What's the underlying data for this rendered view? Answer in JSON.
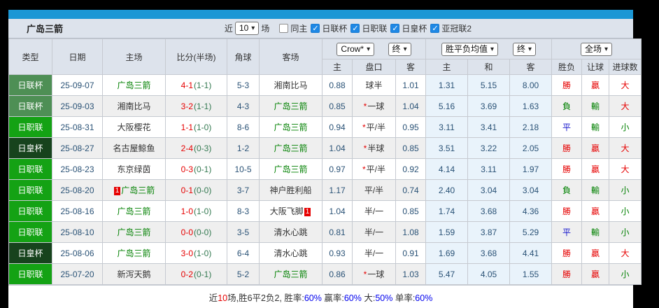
{
  "colors": {
    "accent_blue": "#1b97d5",
    "league_cup_green": "#4e8f55",
    "j_league_green": "#14a214",
    "emperor_cup_green": "#17431d",
    "win_red": "#e60000",
    "lose_green": "#008000",
    "draw_blue": "#1414cc",
    "percent_blue": "#0000ee",
    "avg_column_bg": "#e9f3fb"
  },
  "header": {
    "team": "广岛三箭",
    "recent_label": "近",
    "recent_count": "10",
    "matches_label": "场",
    "filters": [
      {
        "label": "同主",
        "checked": false
      },
      {
        "label": "日联杯",
        "checked": true
      },
      {
        "label": "日职联",
        "checked": true
      },
      {
        "label": "日皇杯",
        "checked": true
      },
      {
        "label": "亚冠联2",
        "checked": true
      }
    ]
  },
  "table": {
    "columns": [
      "类型",
      "日期",
      "主场",
      "比分(半场)",
      "角球",
      "客场"
    ],
    "selects": {
      "bookmaker": "Crow*",
      "asia_time": "终",
      "europe_avg": "胜平负均值",
      "europe_time": "终",
      "scope": "全场"
    },
    "sub_columns": [
      "主",
      "盘口",
      "客",
      "主",
      "和",
      "客",
      "胜负",
      "让球",
      "进球数"
    ],
    "rows": [
      {
        "league": {
          "label": "日联杯",
          "key": "lc"
        },
        "date": "25-09-07",
        "home": {
          "name": "广岛三箭",
          "green": true,
          "rank": ""
        },
        "score": {
          "ft": "4-1",
          "ht": "(1-1)"
        },
        "corners": "5-3",
        "away": {
          "name": "湘南比马",
          "green": false,
          "rank": ""
        },
        "asia": {
          "home": "0.88",
          "star": false,
          "line": "球半",
          "away": "1.01"
        },
        "europe": {
          "home": "1.31",
          "draw": "5.15",
          "away": "8.00"
        },
        "results": [
          {
            "t": "勝",
            "c": "r"
          },
          {
            "t": "贏",
            "c": "r"
          },
          {
            "t": "大",
            "c": "r"
          }
        ]
      },
      {
        "league": {
          "label": "日联杯",
          "key": "lc"
        },
        "date": "25-09-03",
        "home": {
          "name": "湘南比马",
          "green": false,
          "rank": ""
        },
        "score": {
          "ft": "3-2",
          "ht": "(1-1)"
        },
        "corners": "4-3",
        "away": {
          "name": "广岛三箭",
          "green": true,
          "rank": ""
        },
        "asia": {
          "home": "0.85",
          "star": true,
          "line": "一球",
          "away": "1.04"
        },
        "europe": {
          "home": "5.16",
          "draw": "3.69",
          "away": "1.63"
        },
        "results": [
          {
            "t": "負",
            "c": "g"
          },
          {
            "t": "輸",
            "c": "g"
          },
          {
            "t": "大",
            "c": "r"
          }
        ]
      },
      {
        "league": {
          "label": "日职联",
          "key": "jl"
        },
        "date": "25-08-31",
        "home": {
          "name": "大阪樱花",
          "green": false,
          "rank": ""
        },
        "score": {
          "ft": "1-1",
          "ht": "(1-0)"
        },
        "corners": "8-6",
        "away": {
          "name": "广岛三箭",
          "green": true,
          "rank": ""
        },
        "asia": {
          "home": "0.94",
          "star": true,
          "line": "平/半",
          "away": "0.95"
        },
        "europe": {
          "home": "3.11",
          "draw": "3.41",
          "away": "2.18"
        },
        "results": [
          {
            "t": "平",
            "c": "b"
          },
          {
            "t": "輸",
            "c": "g"
          },
          {
            "t": "小",
            "c": "g"
          }
        ]
      },
      {
        "league": {
          "label": "日皇杯",
          "key": "ec"
        },
        "date": "25-08-27",
        "home": {
          "name": "名古屋鲸鱼",
          "green": false,
          "rank": ""
        },
        "score": {
          "ft": "2-4",
          "ht": "(0-3)"
        },
        "corners": "1-2",
        "away": {
          "name": "广岛三箭",
          "green": true,
          "rank": ""
        },
        "asia": {
          "home": "1.04",
          "star": true,
          "line": "半球",
          "away": "0.85"
        },
        "europe": {
          "home": "3.51",
          "draw": "3.22",
          "away": "2.05"
        },
        "results": [
          {
            "t": "勝",
            "c": "r"
          },
          {
            "t": "贏",
            "c": "r"
          },
          {
            "t": "大",
            "c": "r"
          }
        ]
      },
      {
        "league": {
          "label": "日职联",
          "key": "jl"
        },
        "date": "25-08-23",
        "home": {
          "name": "东京绿茵",
          "green": false,
          "rank": ""
        },
        "score": {
          "ft": "0-3",
          "ht": "(0-1)"
        },
        "corners": "10-5",
        "away": {
          "name": "广岛三箭",
          "green": true,
          "rank": ""
        },
        "asia": {
          "home": "0.97",
          "star": true,
          "line": "平/半",
          "away": "0.92"
        },
        "europe": {
          "home": "4.14",
          "draw": "3.11",
          "away": "1.97"
        },
        "results": [
          {
            "t": "勝",
            "c": "r"
          },
          {
            "t": "贏",
            "c": "r"
          },
          {
            "t": "大",
            "c": "r"
          }
        ]
      },
      {
        "league": {
          "label": "日职联",
          "key": "jl"
        },
        "date": "25-08-20",
        "home": {
          "name": "广岛三箭",
          "green": true,
          "rank": "1"
        },
        "score": {
          "ft": "0-1",
          "ht": "(0-0)"
        },
        "corners": "3-7",
        "away": {
          "name": "神户胜利船",
          "green": false,
          "rank": ""
        },
        "asia": {
          "home": "1.17",
          "star": false,
          "line": "平/半",
          "away": "0.74"
        },
        "europe": {
          "home": "2.40",
          "draw": "3.04",
          "away": "3.04"
        },
        "results": [
          {
            "t": "負",
            "c": "g"
          },
          {
            "t": "輸",
            "c": "g"
          },
          {
            "t": "小",
            "c": "g"
          }
        ]
      },
      {
        "league": {
          "label": "日职联",
          "key": "jl"
        },
        "date": "25-08-16",
        "home": {
          "name": "广岛三箭",
          "green": true,
          "rank": ""
        },
        "score": {
          "ft": "1-0",
          "ht": "(1-0)"
        },
        "corners": "8-3",
        "away": {
          "name": "大阪飞脚",
          "green": false,
          "rank": "1"
        },
        "asia": {
          "home": "1.04",
          "star": false,
          "line": "半/一",
          "away": "0.85"
        },
        "europe": {
          "home": "1.74",
          "draw": "3.68",
          "away": "4.36"
        },
        "results": [
          {
            "t": "勝",
            "c": "r"
          },
          {
            "t": "贏",
            "c": "r"
          },
          {
            "t": "小",
            "c": "g"
          }
        ]
      },
      {
        "league": {
          "label": "日职联",
          "key": "jl"
        },
        "date": "25-08-10",
        "home": {
          "name": "广岛三箭",
          "green": true,
          "rank": ""
        },
        "score": {
          "ft": "0-0",
          "ht": "(0-0)"
        },
        "corners": "3-5",
        "away": {
          "name": "清水心跳",
          "green": false,
          "rank": ""
        },
        "asia": {
          "home": "0.81",
          "star": false,
          "line": "半/一",
          "away": "1.08"
        },
        "europe": {
          "home": "1.59",
          "draw": "3.87",
          "away": "5.29"
        },
        "results": [
          {
            "t": "平",
            "c": "b"
          },
          {
            "t": "輸",
            "c": "g"
          },
          {
            "t": "小",
            "c": "g"
          }
        ]
      },
      {
        "league": {
          "label": "日皇杯",
          "key": "ec"
        },
        "date": "25-08-06",
        "home": {
          "name": "广岛三箭",
          "green": true,
          "rank": ""
        },
        "score": {
          "ft": "3-0",
          "ht": "(1-0)"
        },
        "corners": "6-4",
        "away": {
          "name": "清水心跳",
          "green": false,
          "rank": ""
        },
        "asia": {
          "home": "0.93",
          "star": false,
          "line": "半/一",
          "away": "0.91"
        },
        "europe": {
          "home": "1.69",
          "draw": "3.68",
          "away": "4.41"
        },
        "results": [
          {
            "t": "勝",
            "c": "r"
          },
          {
            "t": "贏",
            "c": "r"
          },
          {
            "t": "大",
            "c": "r"
          }
        ]
      },
      {
        "league": {
          "label": "日职联",
          "key": "jl"
        },
        "date": "25-07-20",
        "home": {
          "name": "新泻天鹅",
          "green": false,
          "rank": ""
        },
        "score": {
          "ft": "0-2",
          "ht": "(0-1)"
        },
        "corners": "5-2",
        "away": {
          "name": "广岛三箭",
          "green": true,
          "rank": ""
        },
        "asia": {
          "home": "0.86",
          "star": true,
          "line": "一球",
          "away": "1.03"
        },
        "europe": {
          "home": "5.47",
          "draw": "4.05",
          "away": "1.55"
        },
        "results": [
          {
            "t": "勝",
            "c": "r"
          },
          {
            "t": "贏",
            "c": "r"
          },
          {
            "t": "小",
            "c": "g"
          }
        ]
      }
    ]
  },
  "footer": {
    "p1": "近",
    "p2": "10",
    "p3": "场,胜6平2负2, 胜率:",
    "p4": "60%",
    "p5": " 赢率:",
    "p6": "60%",
    "p7": " 大:",
    "p8": "50%",
    "p9": " 单率:",
    "p10": "60%"
  }
}
